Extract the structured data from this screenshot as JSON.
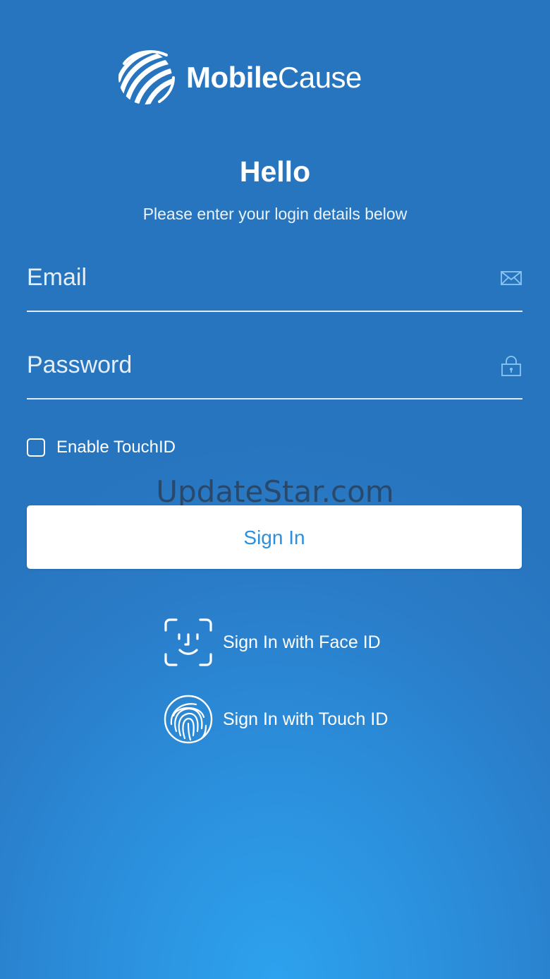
{
  "brand": {
    "name_bold": "Mobile",
    "name_light": "Cause",
    "logo_icon": "globe-swoosh-icon"
  },
  "header": {
    "title": "Hello",
    "subtitle": "Please enter your login details below"
  },
  "form": {
    "email": {
      "placeholder": "Email",
      "value": "",
      "icon": "envelope-icon"
    },
    "password": {
      "placeholder": "Password",
      "value": "",
      "icon": "lock-icon"
    },
    "enable_touchid": {
      "label": "Enable TouchID",
      "checked": false
    },
    "sign_in_label": "Sign In"
  },
  "biometrics": {
    "face_id": {
      "label": "Sign In with Face ID",
      "icon": "face-id-icon"
    },
    "touch_id": {
      "label": "Sign In with Touch ID",
      "icon": "fingerprint-icon"
    }
  },
  "watermark": "UpdateStar.com",
  "colors": {
    "background_top": "#2875bf",
    "background_bottom": "#2da2ee",
    "button_background": "#ffffff",
    "button_text": "#2c8fdc",
    "text": "#ffffff"
  }
}
